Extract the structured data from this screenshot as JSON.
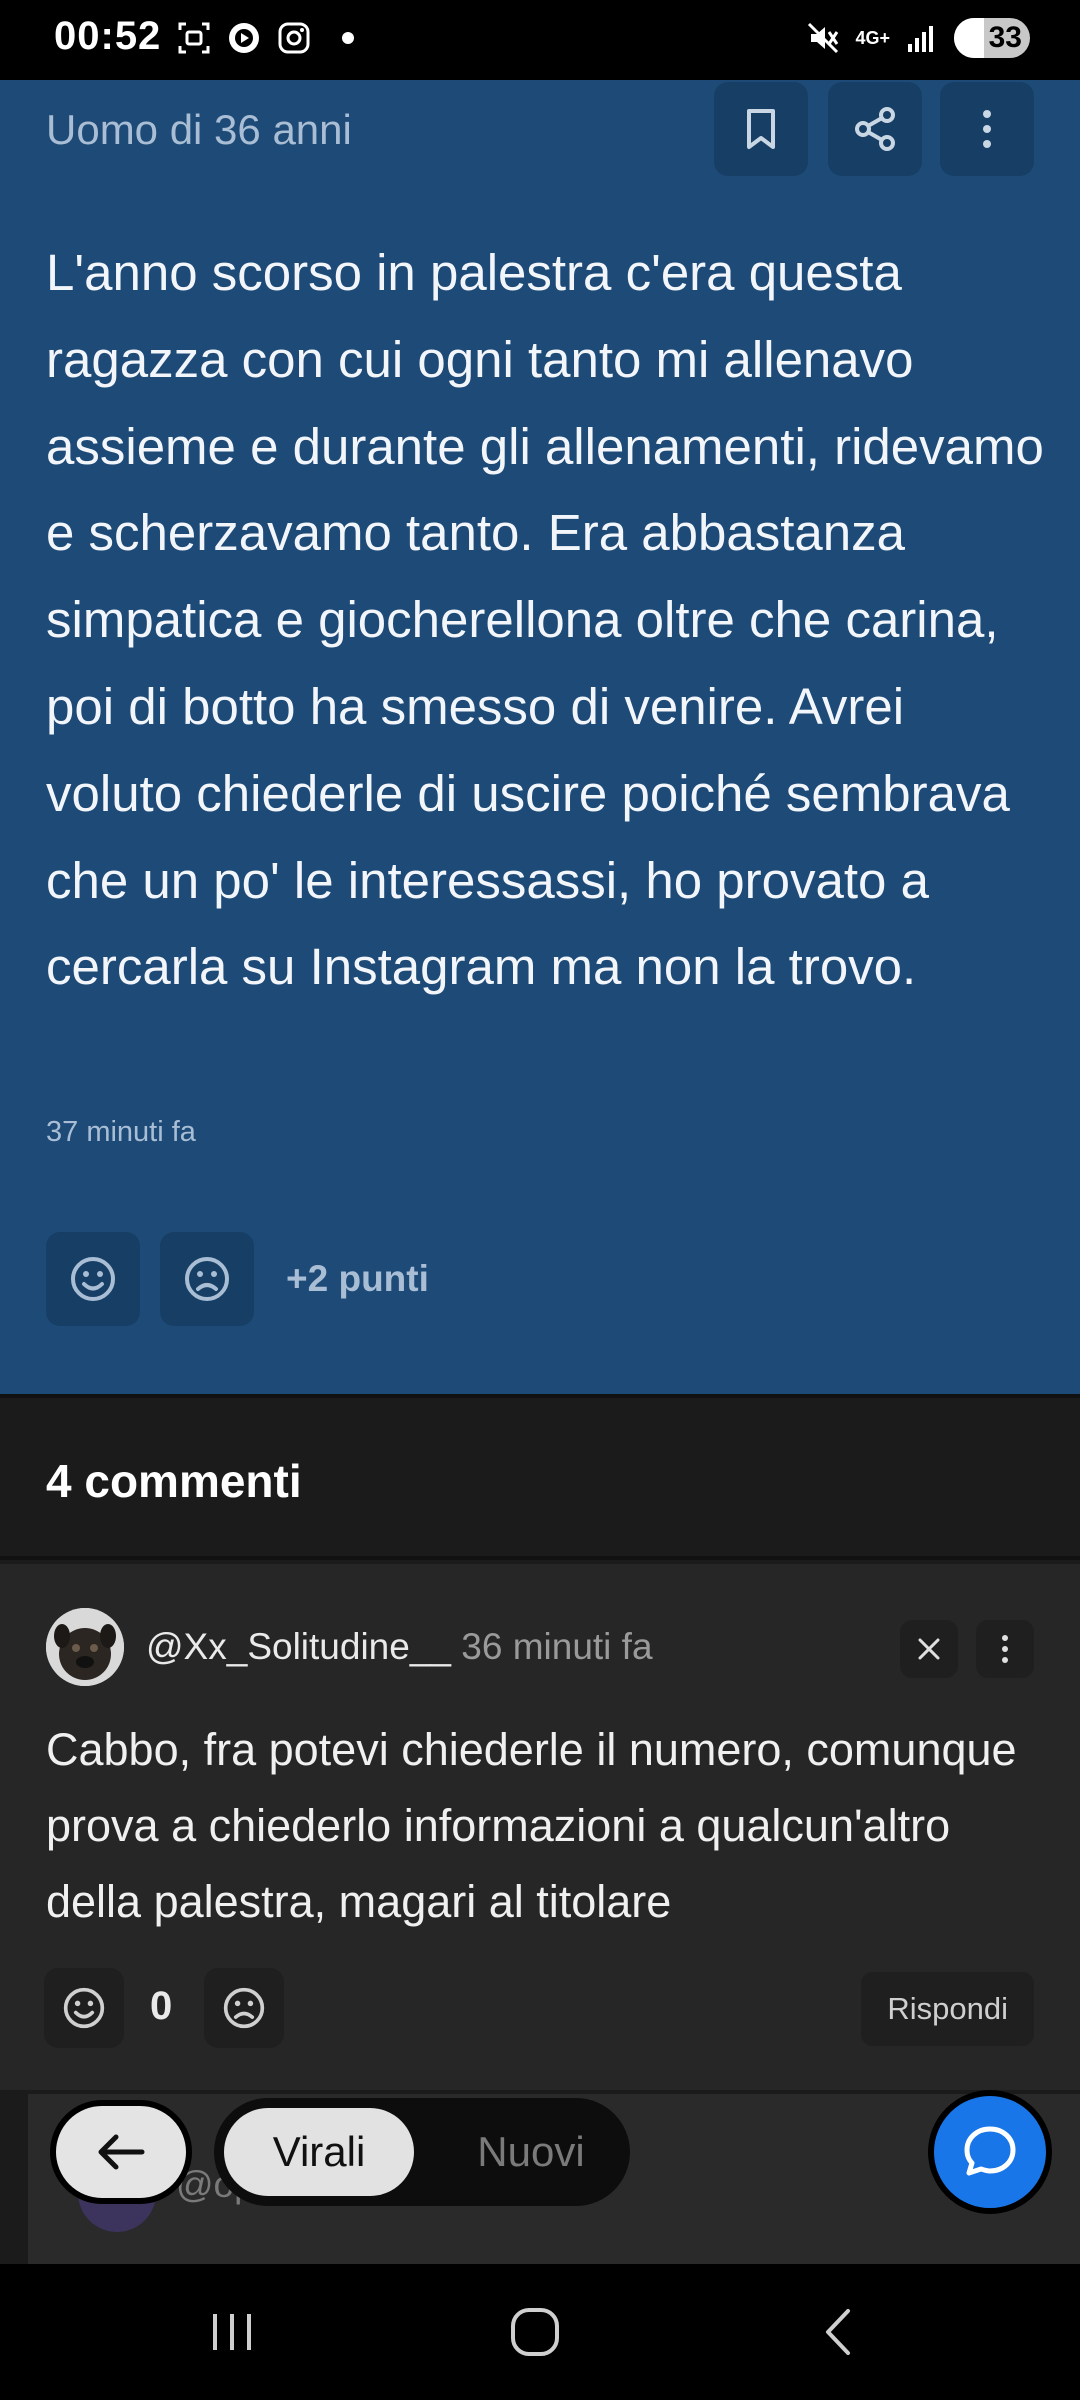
{
  "status_bar": {
    "time": "00:52",
    "network": "4G+",
    "battery": "33",
    "icons": [
      "screenshot-icon",
      "youtube-music-icon",
      "instagram-icon",
      "notification-dot",
      "mute-icon",
      "signal-icon",
      "battery-icon"
    ]
  },
  "post": {
    "author": "Uomo di 36 anni",
    "body": "L'anno scorso in palestra c'era questa ragazza con cui ogni tanto mi allenavo assieme e durante gli allenamenti, ridevamo e scherzavamo tanto. Era abbastanza simpatica e giocherellona oltre che carina, poi di botto ha smesso di venire. Avrei voluto chiederle di uscire poiché sembrava che un po' le interessassi, ho provato a cercarla su Instagram ma non la trovo.",
    "time": "37 minuti fa",
    "points": "+2 punti",
    "background": "#1d4a77"
  },
  "comments": {
    "title": "4 commenti",
    "first": {
      "user": "@Xx_Solitudine__",
      "time": "36 minuti fa",
      "text": "Cabbo, fra potevi chiederle il numero, comunque prova a chiederlo informazioni a qualcun'altro della palestra, magari al titolare",
      "score": "0",
      "reply_label": "Rispondi"
    },
    "next": {
      "user": "@op 10 minuti fa"
    }
  },
  "controls": {
    "tab_active": "Virali",
    "tab_inactive": "Nuovi",
    "chat_color": "#1876e8"
  }
}
